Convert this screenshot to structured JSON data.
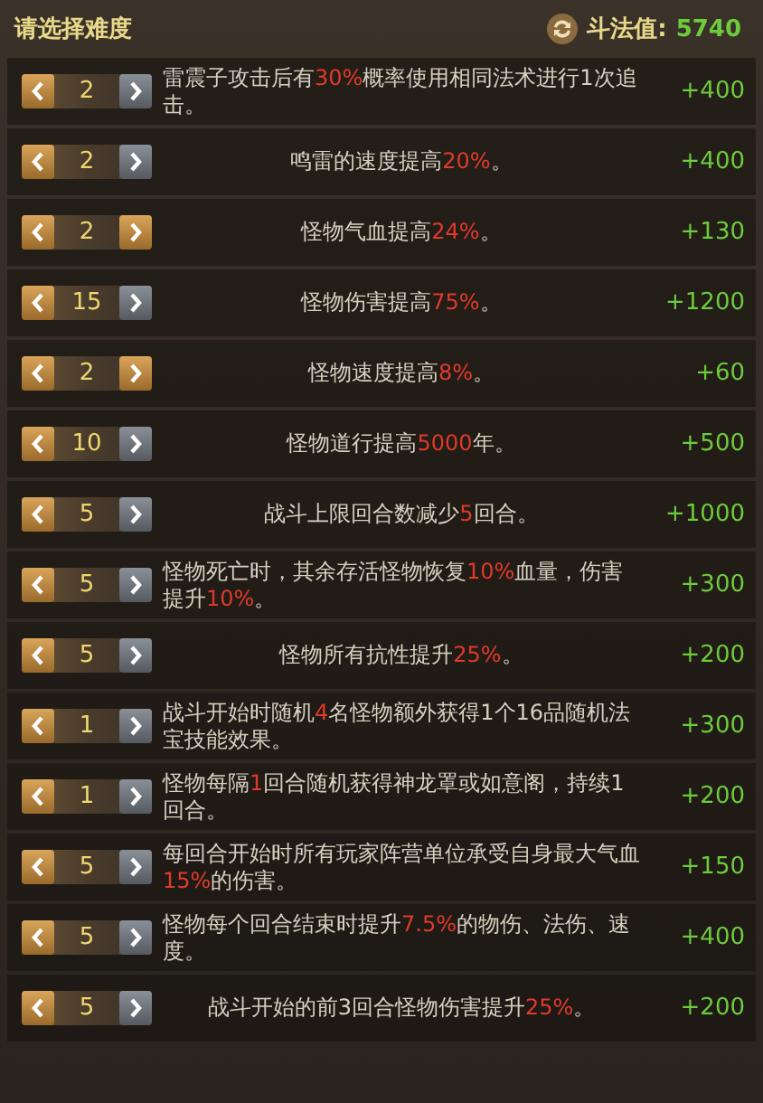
{
  "header": {
    "title": "请选择难度",
    "score_label": "斗法值:",
    "score_value": "5740"
  },
  "rows": [
    {
      "value": "2",
      "right_enabled": false,
      "text": [
        {
          "text": "雷震子攻击后有",
          "highlight": false
        },
        {
          "text": "30%",
          "highlight": true
        },
        {
          "text": "概率使用相同法术进行1次追击。",
          "highlight": false
        }
      ],
      "bonus": "+400"
    },
    {
      "value": "2",
      "right_enabled": false,
      "text": [
        {
          "text": "鸣雷的速度提高",
          "highlight": false
        },
        {
          "text": "20%",
          "highlight": true
        },
        {
          "text": "。",
          "highlight": false
        }
      ],
      "bonus": "+400"
    },
    {
      "value": "2",
      "right_enabled": true,
      "text": [
        {
          "text": "怪物气血提高",
          "highlight": false
        },
        {
          "text": "24%",
          "highlight": true
        },
        {
          "text": "。",
          "highlight": false
        }
      ],
      "bonus": "+130"
    },
    {
      "value": "15",
      "right_enabled": false,
      "text": [
        {
          "text": "怪物伤害提高",
          "highlight": false
        },
        {
          "text": "75%",
          "highlight": true
        },
        {
          "text": "。",
          "highlight": false
        }
      ],
      "bonus": "+1200"
    },
    {
      "value": "2",
      "right_enabled": true,
      "text": [
        {
          "text": "怪物速度提高",
          "highlight": false
        },
        {
          "text": "8%",
          "highlight": true
        },
        {
          "text": "。",
          "highlight": false
        }
      ],
      "bonus": "+60"
    },
    {
      "value": "10",
      "right_enabled": false,
      "text": [
        {
          "text": "怪物道行提高",
          "highlight": false
        },
        {
          "text": "5000",
          "highlight": true
        },
        {
          "text": "年。",
          "highlight": false
        }
      ],
      "bonus": "+500"
    },
    {
      "value": "5",
      "right_enabled": false,
      "text": [
        {
          "text": "战斗上限回合数减少",
          "highlight": false
        },
        {
          "text": "5",
          "highlight": true
        },
        {
          "text": "回合。",
          "highlight": false
        }
      ],
      "bonus": "+1000"
    },
    {
      "value": "5",
      "right_enabled": false,
      "text": [
        {
          "text": "怪物死亡时，其余存活怪物恢复",
          "highlight": false
        },
        {
          "text": "10%",
          "highlight": true
        },
        {
          "text": "血量，伤害提升",
          "highlight": false
        },
        {
          "text": "10%",
          "highlight": true
        },
        {
          "text": "。",
          "highlight": false
        }
      ],
      "bonus": "+300"
    },
    {
      "value": "5",
      "right_enabled": false,
      "text": [
        {
          "text": "怪物所有抗性提升",
          "highlight": false
        },
        {
          "text": "25%",
          "highlight": true
        },
        {
          "text": "。",
          "highlight": false
        }
      ],
      "bonus": "+200"
    },
    {
      "value": "1",
      "right_enabled": false,
      "text": [
        {
          "text": "战斗开始时随机",
          "highlight": false
        },
        {
          "text": "4",
          "highlight": true
        },
        {
          "text": "名怪物额外获得1个16品随机法宝技能效果。",
          "highlight": false
        }
      ],
      "bonus": "+300"
    },
    {
      "value": "1",
      "right_enabled": false,
      "text": [
        {
          "text": "怪物每隔",
          "highlight": false
        },
        {
          "text": "1",
          "highlight": true
        },
        {
          "text": "回合随机获得神龙罩或如意阁，持续1回合。",
          "highlight": false
        }
      ],
      "bonus": "+200"
    },
    {
      "value": "5",
      "right_enabled": false,
      "text": [
        {
          "text": "每回合开始时所有玩家阵营单位承受自身最大气血",
          "highlight": false
        },
        {
          "text": "15%",
          "highlight": true
        },
        {
          "text": "的伤害。",
          "highlight": false
        }
      ],
      "bonus": "+150"
    },
    {
      "value": "5",
      "right_enabled": false,
      "text": [
        {
          "text": "怪物每个回合结束时提升",
          "highlight": false
        },
        {
          "text": "7.5%",
          "highlight": true
        },
        {
          "text": "的物伤、法伤、速度。",
          "highlight": false
        }
      ],
      "bonus": "+400"
    },
    {
      "value": "5",
      "right_enabled": false,
      "text": [
        {
          "text": "战斗开始的前3回合怪物伤害提升",
          "highlight": false
        },
        {
          "text": "25%",
          "highlight": true
        },
        {
          "text": "。",
          "highlight": false
        }
      ],
      "bonus": "+200"
    }
  ]
}
